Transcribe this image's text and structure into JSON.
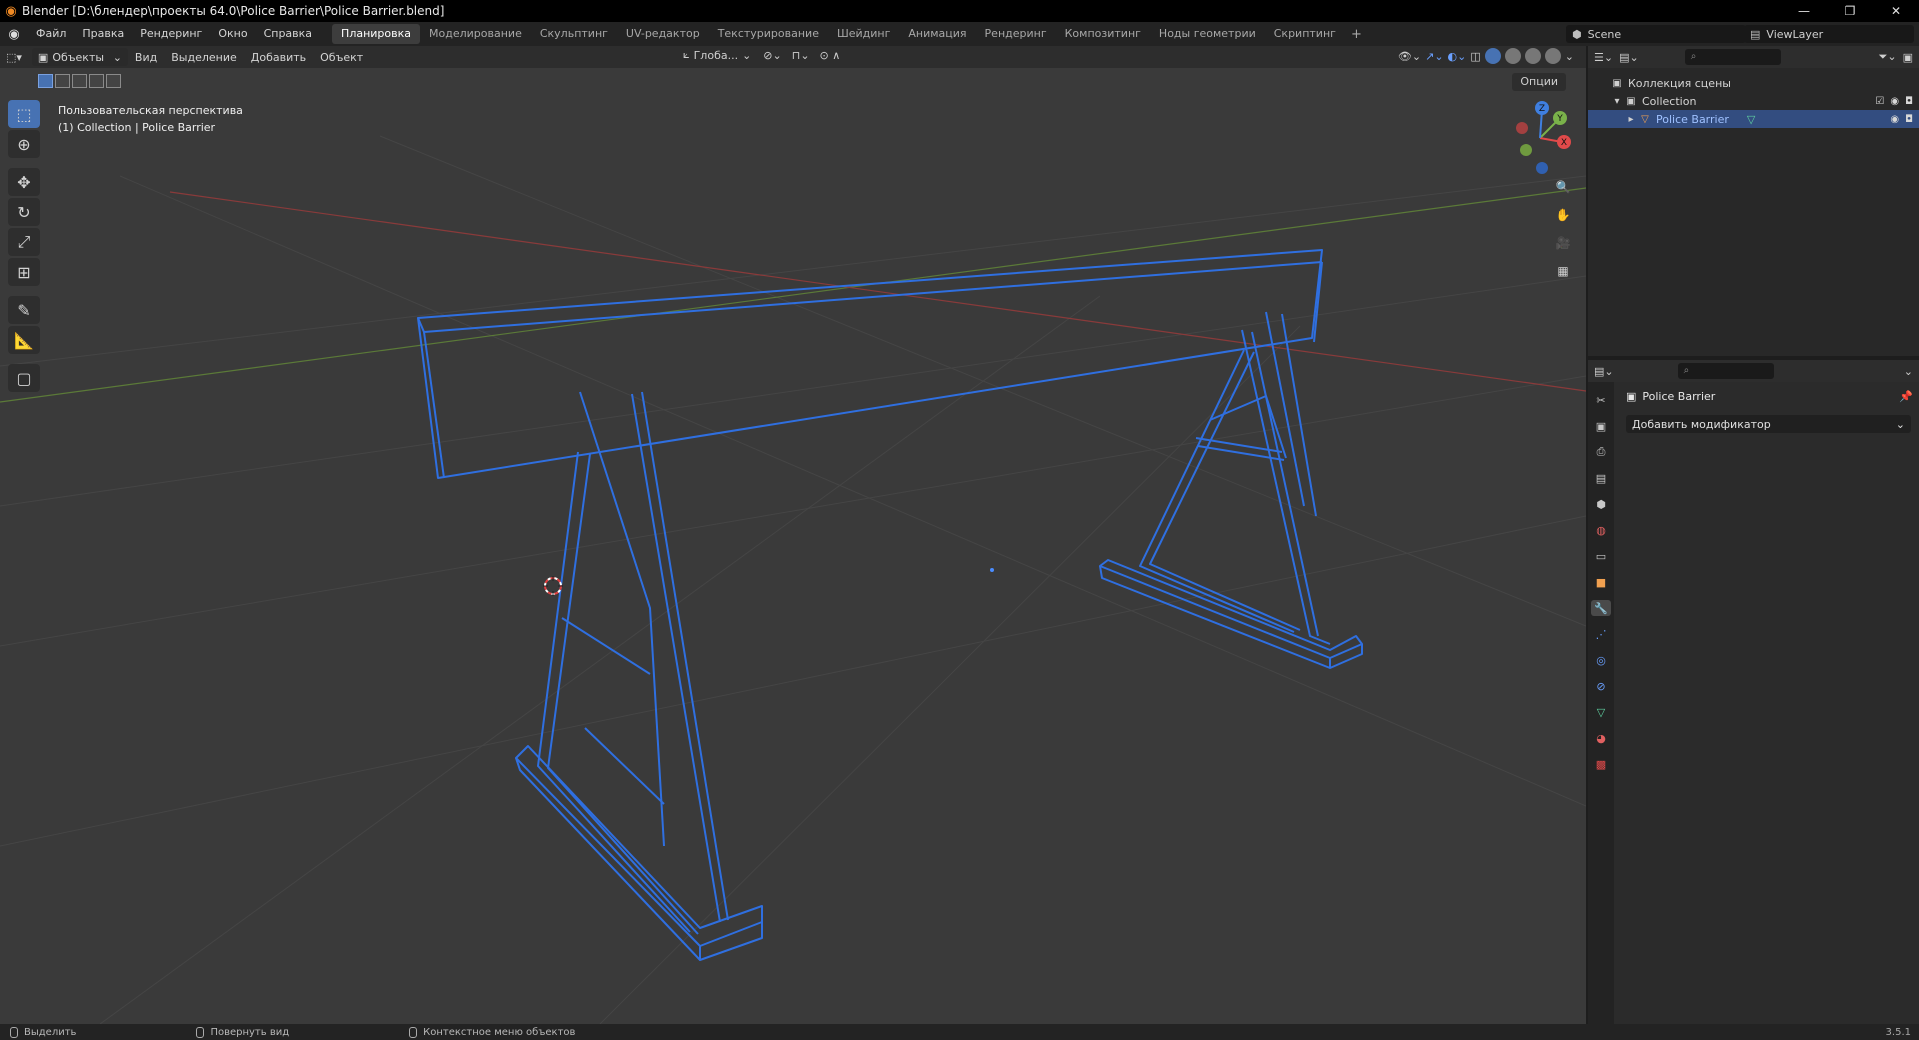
{
  "window": {
    "title": "Blender [D:\\блендер\\проекты 64.0\\Police Barrier\\Police Barrier.blend]",
    "controls": [
      "—",
      "❐",
      "✕"
    ]
  },
  "menu": [
    "Файл",
    "Правка",
    "Рендеринг",
    "Окно",
    "Справка"
  ],
  "workspaces": {
    "tabs": [
      "Планировка",
      "Моделирование",
      "Скульптинг",
      "UV-редактор",
      "Текстурирование",
      "Шейдинг",
      "Анимация",
      "Рендеринг",
      "Композитинг",
      "Ноды геометрии",
      "Скриптинг"
    ],
    "active": "Планировка",
    "add": "+"
  },
  "scene": {
    "name": "Scene",
    "view_layer": "ViewLayer"
  },
  "viewport": {
    "mode": "Объекты",
    "menus": [
      "Вид",
      "Выделение",
      "Добавить",
      "Объект"
    ],
    "orientation": "Глоба...",
    "options": "Опции",
    "info_line1": "Пользовательская перспектива",
    "info_line2": "(1) Collection | Police Barrier",
    "gizmo_labels": {
      "x": "X",
      "y": "Y",
      "z": "Z"
    },
    "accent": "#2f6fe0"
  },
  "outliner": {
    "scene_collection": "Коллекция сцены",
    "collection": "Collection",
    "object": "Police Barrier"
  },
  "properties": {
    "object_name": "Police Barrier",
    "add_modifier": "Добавить модификатор"
  },
  "statusbar": {
    "select": "Выделить",
    "rotate": "Повернуть вид",
    "context": "Контекстное меню объектов",
    "version": "3.5.1"
  }
}
